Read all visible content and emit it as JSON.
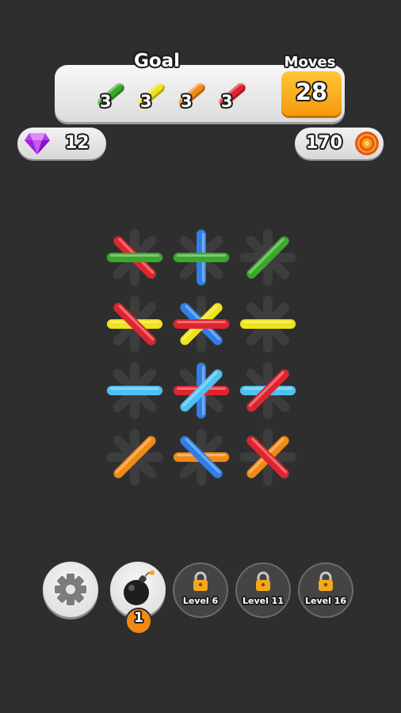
{
  "goal": {
    "title": "Goal",
    "items": [
      {
        "color": "#3aa82b",
        "count": "3"
      },
      {
        "color": "#f0e21b",
        "count": "3"
      },
      {
        "color": "#f08a14",
        "count": "3"
      },
      {
        "color": "#e0242e",
        "count": "3"
      }
    ]
  },
  "moves": {
    "label": "Moves",
    "value": "28"
  },
  "currency": {
    "gems": "12",
    "coins": "170"
  },
  "colors": {
    "green": "#3aa82b",
    "blue": "#2f7fe6",
    "red": "#e0242e",
    "yellow": "#f0e21b",
    "lightblue": "#4fc0f0",
    "orange": "#f08a14",
    "slot": "#3d3d3d"
  },
  "board": {
    "rows": 4,
    "cols": 3,
    "cells": [
      [
        {
          "angle": 45,
          "color": "red"
        },
        {
          "angle": 0,
          "color": "green"
        }
      ],
      [
        {
          "angle": 90,
          "color": "blue"
        },
        {
          "angle": 0,
          "color": "green"
        }
      ],
      [
        {
          "angle": -45,
          "color": "green"
        }
      ],
      [
        {
          "angle": 0,
          "color": "yellow"
        },
        {
          "angle": 45,
          "color": "red"
        }
      ],
      [
        {
          "angle": 45,
          "color": "blue"
        },
        {
          "angle": -45,
          "color": "yellow"
        },
        {
          "angle": 0,
          "color": "red"
        }
      ],
      [
        {
          "angle": 0,
          "color": "yellow"
        }
      ],
      [
        {
          "angle": 0,
          "color": "lightblue"
        }
      ],
      [
        {
          "angle": 90,
          "color": "blue"
        },
        {
          "angle": 0,
          "color": "red"
        },
        {
          "angle": -45,
          "color": "lightblue"
        }
      ],
      [
        {
          "angle": 0,
          "color": "lightblue"
        },
        {
          "angle": -45,
          "color": "red"
        }
      ],
      [
        {
          "angle": -45,
          "color": "orange"
        }
      ],
      [
        {
          "angle": 0,
          "color": "orange"
        },
        {
          "angle": 45,
          "color": "blue"
        }
      ],
      [
        {
          "angle": -45,
          "color": "orange"
        },
        {
          "angle": 45,
          "color": "red"
        }
      ]
    ]
  },
  "boosters": {
    "settings_icon": "gear-icon",
    "bomb_icon": "bomb-icon",
    "bomb_count": "1",
    "locked": [
      {
        "label": "Level 6",
        "icon": "padlock-icon"
      },
      {
        "label": "Level 11",
        "icon": "padlock-icon"
      },
      {
        "label": "Level 16",
        "icon": "padlock-icon"
      }
    ]
  }
}
